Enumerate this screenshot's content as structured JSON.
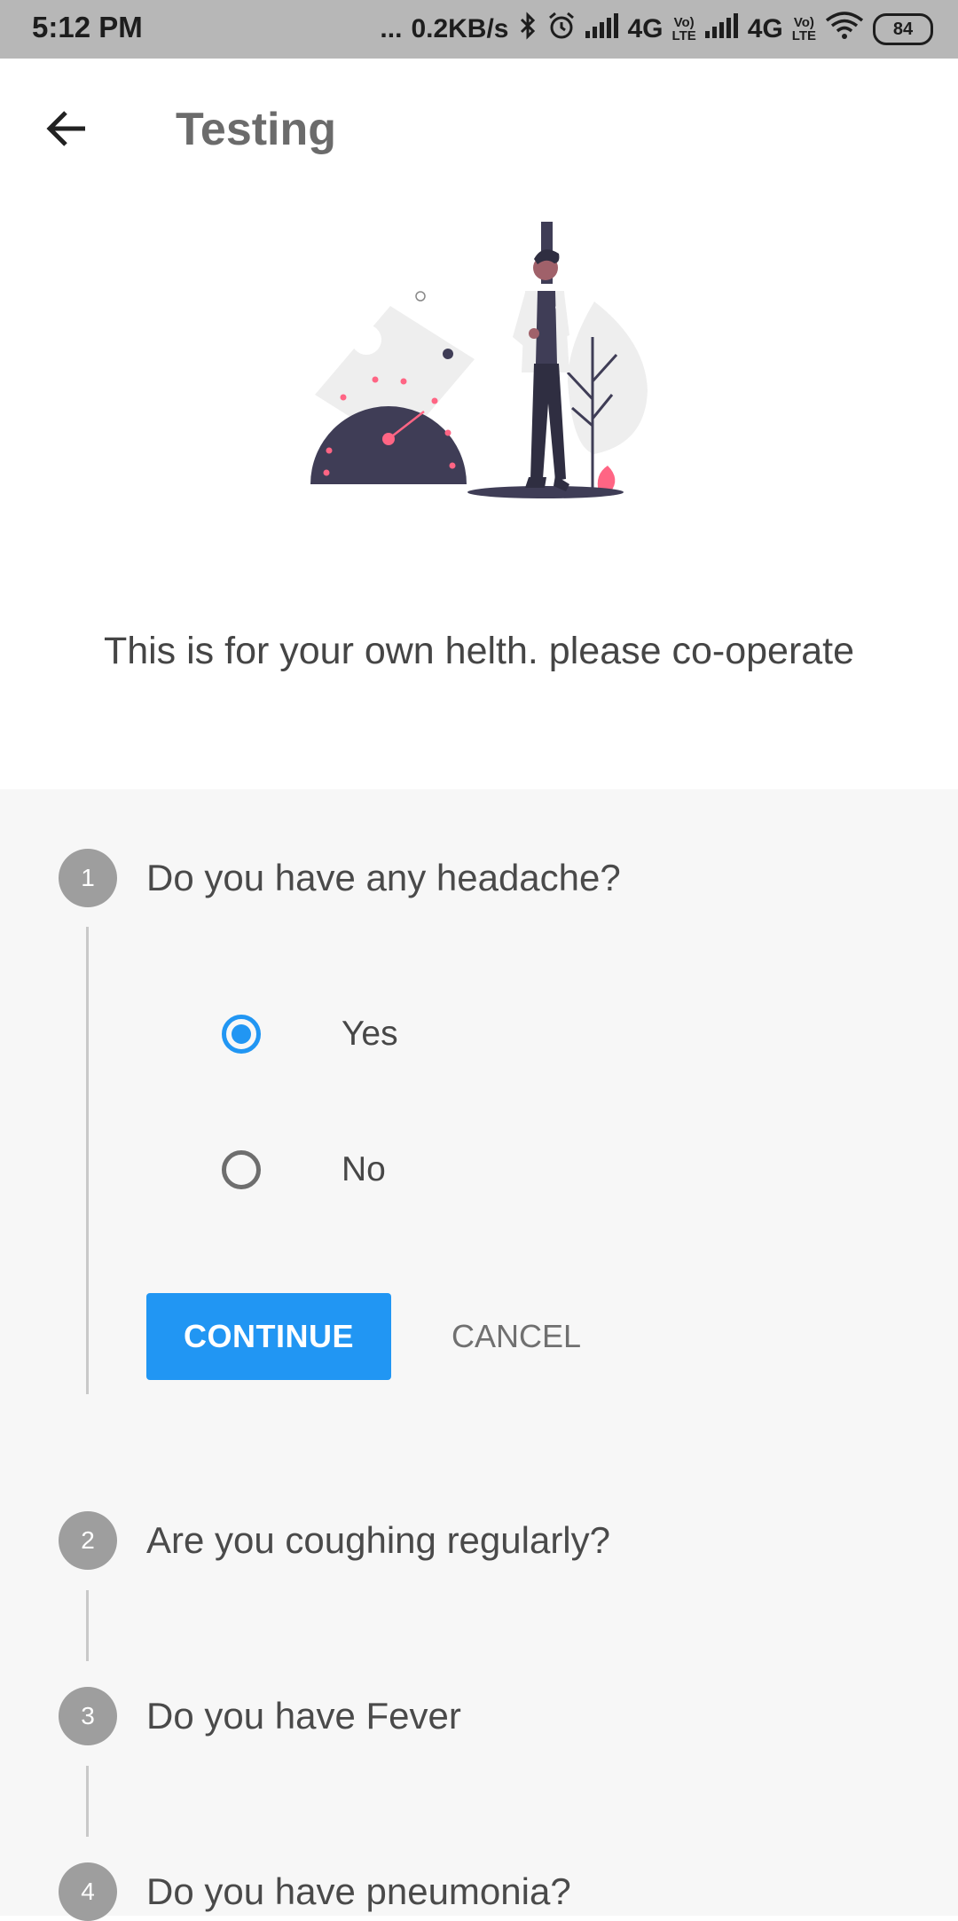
{
  "status_bar": {
    "time": "5:12 PM",
    "dots": "...",
    "network_speed": "0.2KB/s",
    "net1": "4G",
    "volte1_top": "Vo)",
    "volte1_bottom": "LTE",
    "net2": "4G",
    "volte2_top": "Vo)",
    "volte2_bottom": "LTE",
    "battery": "84"
  },
  "app_bar": {
    "title": "Testing",
    "back_icon": "arrow-left-icon"
  },
  "subtitle": "This is for your own helth. please co-operate",
  "steps": [
    {
      "number": "1",
      "question": "Do you have any headache?"
    },
    {
      "number": "2",
      "question": "Are you coughing regularly?"
    },
    {
      "number": "3",
      "question": "Do you have Fever"
    },
    {
      "number": "4",
      "question": "Do you have pneumonia?"
    }
  ],
  "options": [
    {
      "label": "Yes",
      "selected": true
    },
    {
      "label": "No",
      "selected": false
    }
  ],
  "buttons": {
    "continue": "CONTINUE",
    "cancel": "CANCEL"
  },
  "colors": {
    "accent": "#2196f3",
    "status_bar": "#b7b7b7",
    "step_circle": "#9e9e9e",
    "illustration_dark": "#3f3d56",
    "illustration_pink": "#ff6584"
  }
}
